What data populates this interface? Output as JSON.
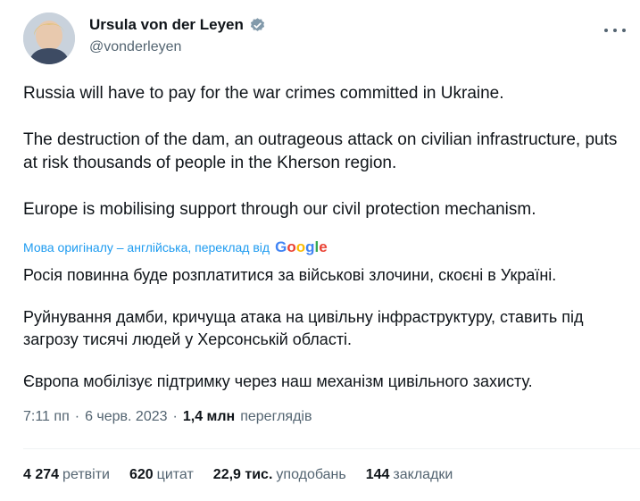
{
  "author": {
    "name": "Ursula von der Leyen",
    "handle": "@vonderleyen"
  },
  "tweet": {
    "paragraphs": [
      "Russia will have to pay for the war crimes committed in Ukraine.",
      "The destruction of the dam, an outrageous attack on civilian infrastructure, puts at risk thousands of people in the Kherson region.",
      "Europe is mobilising support through our civil protection mechanism."
    ]
  },
  "translation": {
    "note": "Мова оригіналу – англійська, переклад від",
    "provider": "Google",
    "paragraphs": [
      "Росія повинна буде розплатитися за військові злочини, скоєні в Україні.",
      "Руйнування дамби, кричуща атака на цивільну інфраструктуру, ставить під загрозу тисячі людей у Херсонській області.",
      "Європа мобілізує підтримку через наш механізм цивільного захисту."
    ]
  },
  "meta": {
    "time": "7:11 пп",
    "date": "6 черв. 2023",
    "views_count": "1,4 млн",
    "views_label": "переглядів",
    "separator": "·"
  },
  "stats": [
    {
      "count": "4 274",
      "label": "ретвіти"
    },
    {
      "count": "620",
      "label": "цитат"
    },
    {
      "count": "22,9 тис.",
      "label": "уподобань"
    },
    {
      "count": "144",
      "label": "закладки"
    }
  ],
  "colors": {
    "accent": "#1d9bf0",
    "secondary_text": "#536471",
    "primary_text": "#0f1419"
  }
}
